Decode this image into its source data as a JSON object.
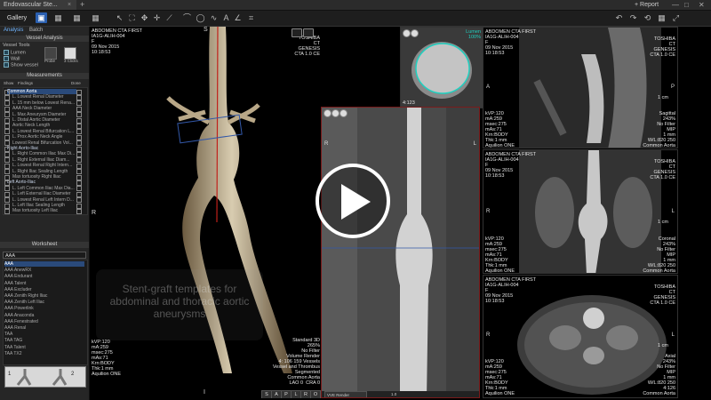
{
  "titlebar": {
    "tab_title": "Endovascular Ste...",
    "tab_close": "×",
    "add_tab": "+",
    "report": "+ Report",
    "minimize": "—",
    "maximize": "□",
    "close": "✕"
  },
  "toolbar": {
    "gallery": "Gallery",
    "icons": [
      "layout-1x1-icon",
      "layout-2x2-icon",
      "layout-3x3-icon",
      "layout-4x4-icon",
      "pointer-icon",
      "select-icon",
      "pan-icon",
      "move-icon",
      "ruler-icon",
      "lasso-icon",
      "ellipse-icon",
      "freehand-icon",
      "text-icon",
      "angle-icon",
      "crop-icon"
    ],
    "right_icons": [
      "undo-icon",
      "redo-icon",
      "reset-icon",
      "grid-icon",
      "fullscreen-icon"
    ]
  },
  "left_panel": {
    "tabs": [
      "Analysis",
      "Batch"
    ],
    "vessel_analysis_header": "Vessel Analysis",
    "vessel_tools_label": "Vessel Tools",
    "lumen": "Lumen",
    "wall": "Wall",
    "show_vessel": "Show vessel",
    "tool_buttons": [
      "Probe",
      "3 Clicks"
    ],
    "measurements_header": "Measurements",
    "meas_columns": [
      "Show",
      "Findings",
      "Done"
    ],
    "measurements": [
      {
        "label": "Common Aorta",
        "header": true,
        "selected": true
      },
      {
        "label": "L. Lowest Renal Diameter"
      },
      {
        "label": "L. 15 mm below Lowest Rena..."
      },
      {
        "label": "AAA Neck Diameter"
      },
      {
        "label": "L. Max Aneurysm Diameter"
      },
      {
        "label": "L. Distal Aortic Diameter"
      },
      {
        "label": "Aortic Neck Length"
      },
      {
        "label": "L. Lowest Renal Bifurcation L..."
      },
      {
        "label": "L. Prox Aortic Neck Angle"
      },
      {
        "label": "Lowest Renal Bifurcation Vol..."
      },
      {
        "label": "Right Aorto-Iliac",
        "header": true
      },
      {
        "label": "L. Right Common Iliac Max Di..."
      },
      {
        "label": "L. Right External Iliac Diam..."
      },
      {
        "label": "L. Lowest Renal Right Intern..."
      },
      {
        "label": "L. Right Iliac Sealing Length"
      },
      {
        "label": "Max tortuosity Right Iliac"
      },
      {
        "label": "Left Aorto-Iliac",
        "header": true
      },
      {
        "label": "L. Left Common Iliac Max Dia..."
      },
      {
        "label": "L. Left External Iliac Diameter"
      },
      {
        "label": "L. Lowest Renal Left Intern D..."
      },
      {
        "label": "L. Left Iliac Sealing Length"
      },
      {
        "label": "Max tortuosity Left Iliac"
      }
    ],
    "worksheet_header": "Worksheet",
    "worksheet_selected": "AAA",
    "worksheet_items": [
      "AAA",
      "AAA AnewRX",
      "AAA Endurant",
      "AAA Talent",
      "AAA Excluder",
      "AAA Zenith Right Iliac",
      "AAA Zenith Left Iliac",
      "AAA Powerlink",
      "AAA Anaconda",
      "AAA Fenestrated",
      "AAA Renal",
      "TAA",
      "TAA TAG",
      "TAA Talent",
      "TAA TX2"
    ],
    "thumb_labels": [
      "1",
      "2"
    ]
  },
  "views": {
    "v3d": {
      "top_left": "ABDOMEN CTA FIRST\nIA1G-ALIH-004\nF\n09 Nov 2015\n10:18:53",
      "top_right": "TOSHIBA\nCT\nGENESIS\nCTA 1.0 CE",
      "bottom_left": "kVP:120\nmA:259\nmsec:275\nmAs:71\nKrn:BODY\nThk:1 mm\nAquilion ONE",
      "bottom_right": "Standard 3D\n265%\nNo Filter\nVolume Render\n4: 106 159 Vessels\nVessel and Thrombus\nSegmented\nCommon Aorta\nLAO 0  CRA 0",
      "orient_top": "S",
      "orient_left": "R",
      "orient_bottom": "I",
      "bottom_buttons": [
        "S",
        "A",
        "P",
        "L",
        "R",
        "O"
      ]
    },
    "cross": {
      "top_right": "Lumen\n100%",
      "bottom_left": "4:123"
    },
    "curved": {
      "top_left": "R",
      "top_right": "L",
      "bottom_bar": "VVE Render",
      "bottom_value": "1.0"
    },
    "sagittal": {
      "top_left": "ABDOMEN CTA FIRST\nIA1G-ALIH-004\nF\n09 Nov 2015\n10:18:53",
      "top_right": "TOSHIBA\nCT\nGENESIS\nCTA 1.0 CE",
      "orient_left": "A",
      "orient_right": "P",
      "bottom_left": "kVP:120\nmA:259\nmsec:275\nmAs:71\nKrn:BODY\nThk:1 mm\nAquilion ONE",
      "bottom_right": "Sagittal\n243%\nNo Filter\nMIP\n1 mm\nW/L:820 250\nCommon Aorta",
      "scale": "1 cm"
    },
    "coronal": {
      "top_left": "ABDOMEN CTA FIRST\nIA1G-ALIH-004\nF\n09 Nov 2015\n10:18:53",
      "top_right": "TOSHIBA\nCT\nGENESIS\nCTA 1.0 CE",
      "orient_left": "R",
      "orient_right": "L",
      "bottom_left": "kVP:120\nmA:259\nmsec:275\nmAs:71\nKrn:BODY\nThk:1 mm\nAquilion ONE",
      "bottom_right": "Coronal\n243%\nNo Filter\nMIP\n1 mm\nW/L:820 250\nCommon Aorta",
      "scale": "1 cm"
    },
    "axial": {
      "top_left": "ABDOMEN CTA FIRST\nIA1G-ALIH-004\nF\n09 Nov 2015\n10:18:53",
      "top_right": "TOSHIBA\nCT\nGENESIS\nCTA 1.0 CE",
      "orient_left": "R",
      "orient_right": "L",
      "bottom_left": "kVP:120\nmA:259\nmsec:275\nmAs:71\nKrn:BODY\nThk:1 mm\nAquilion ONE",
      "bottom_right": "Axial\n243%\nNo Filter\nMIP\n1 mm\nW/L:820 250\n4:126\nCommon Aorta",
      "scale": "1 cm"
    }
  },
  "overlay": {
    "caption": "Stent-graft templates for abdominal and thoracic aortic aneurysms"
  },
  "colors": {
    "accent": "#2a5fb0",
    "panel_bg": "#262626",
    "selected_row": "#2a4a7a",
    "curved_border": "#7a1a1a"
  }
}
